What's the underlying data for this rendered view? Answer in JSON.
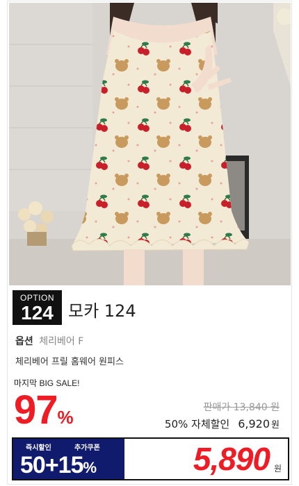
{
  "product": {
    "option_label": "OPTION",
    "option_number": "124",
    "name": "모카 124",
    "option_title": "옵션",
    "option_value": "체리베어 F",
    "description": "체리베어 프릴 홈웨어 원피스"
  },
  "sale": {
    "tag": "마지막 BIG SALE!",
    "discount_rate": "97",
    "percent_sign": "%",
    "original_price": "판매가 13,840 원",
    "self_discount_label": "50% 자체할인",
    "self_discount_price": "6,920",
    "currency": "원"
  },
  "coupon": {
    "instant_label": "즉시할인",
    "extra_label": "추가쿠폰",
    "value": "50+15",
    "percent_sign": "%"
  },
  "final": {
    "price": "5,890",
    "currency": "원"
  },
  "colors": {
    "accent_red": "#ee1c25",
    "coupon_navy": "#111b6e",
    "badge_black": "#111111"
  },
  "image": {
    "subject": "woman wearing cream dress with cherry and bear print"
  }
}
